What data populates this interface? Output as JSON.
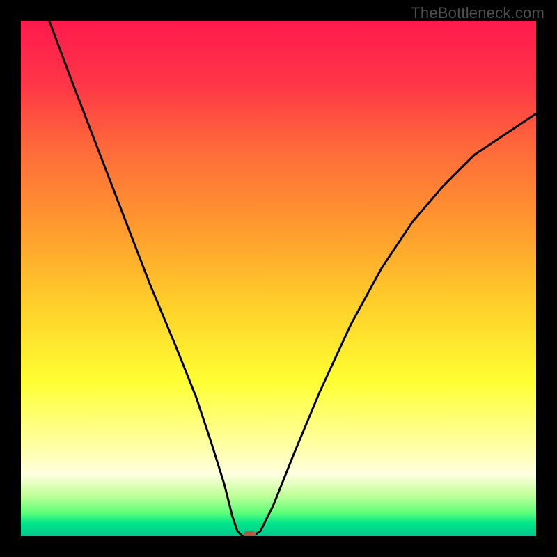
{
  "watermark": "TheBottleneck.com",
  "colors": {
    "frame_background": "#000000",
    "curve_stroke": "#000000",
    "marker": "#b05a4a"
  },
  "chart_data": {
    "type": "line",
    "title": "",
    "xlabel": "",
    "ylabel": "",
    "xlim": [
      0,
      1
    ],
    "ylim": [
      0,
      100
    ],
    "gradient_stops": [
      {
        "offset": 0.0,
        "color": "#ff1a4d"
      },
      {
        "offset": 0.12,
        "color": "#ff3547"
      },
      {
        "offset": 0.25,
        "color": "#ff6a3a"
      },
      {
        "offset": 0.4,
        "color": "#ff9a2e"
      },
      {
        "offset": 0.55,
        "color": "#ffcf2a"
      },
      {
        "offset": 0.7,
        "color": "#ffff33"
      },
      {
        "offset": 0.82,
        "color": "#ffffa0"
      },
      {
        "offset": 0.88,
        "color": "#ffffe0"
      },
      {
        "offset": 0.92,
        "color": "#c4ff9a"
      },
      {
        "offset": 0.955,
        "color": "#5fff7a"
      },
      {
        "offset": 0.975,
        "color": "#00e58a"
      },
      {
        "offset": 1.0,
        "color": "#00c98c"
      }
    ],
    "curve": [
      {
        "x": 0.0,
        "y": 110
      },
      {
        "x": 0.055,
        "y": 100
      },
      {
        "x": 0.1,
        "y": 88
      },
      {
        "x": 0.15,
        "y": 75
      },
      {
        "x": 0.2,
        "y": 62
      },
      {
        "x": 0.25,
        "y": 49
      },
      {
        "x": 0.3,
        "y": 37
      },
      {
        "x": 0.34,
        "y": 27
      },
      {
        "x": 0.37,
        "y": 18
      },
      {
        "x": 0.395,
        "y": 10
      },
      {
        "x": 0.41,
        "y": 4
      },
      {
        "x": 0.42,
        "y": 1
      },
      {
        "x": 0.43,
        "y": 0
      },
      {
        "x": 0.45,
        "y": 0
      },
      {
        "x": 0.465,
        "y": 1
      },
      {
        "x": 0.49,
        "y": 6
      },
      {
        "x": 0.53,
        "y": 16
      },
      {
        "x": 0.58,
        "y": 28
      },
      {
        "x": 0.64,
        "y": 41
      },
      {
        "x": 0.7,
        "y": 52
      },
      {
        "x": 0.76,
        "y": 61
      },
      {
        "x": 0.82,
        "y": 68
      },
      {
        "x": 0.88,
        "y": 74
      },
      {
        "x": 0.94,
        "y": 78
      },
      {
        "x": 1.0,
        "y": 82
      }
    ],
    "marker": {
      "x": 0.445,
      "y": 0
    }
  }
}
